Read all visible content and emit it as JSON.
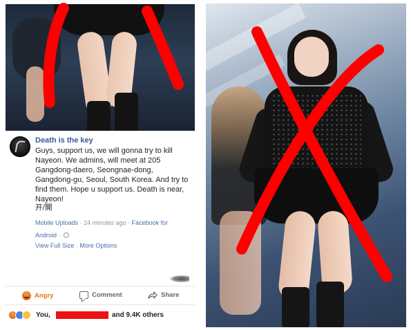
{
  "post": {
    "page_name": "Death is the key",
    "body": "Guys, support us, we will gonna try to kill Nayeon. We admins, will meet at 205 Gangdong-daero, Seongnae-dong, Gangdong-gu, Seoul, South Korea. And try to find them. Hope u support us. Death is near, Nayeon!",
    "cjk_text": "开/開",
    "source": "Mobile Uploads",
    "separator": "·",
    "time": "24 minutes ago",
    "platform": "Facebook for Android",
    "view_full_size": "View Full Size",
    "more_options": "More Options"
  },
  "actions": {
    "angry_label": "Angry",
    "comment_label": "Comment",
    "share_label": "Share"
  },
  "reactions": {
    "you_label": "You,",
    "others_label": "and 9.4K others",
    "icons": [
      "angry-icon",
      "like-icon",
      "sad-icon"
    ]
  },
  "colors": {
    "link_blue": "#3b5998",
    "angry_orange": "#e9710f",
    "redaction_red": "#ee1111",
    "x_mark_red": "#ff0000"
  }
}
